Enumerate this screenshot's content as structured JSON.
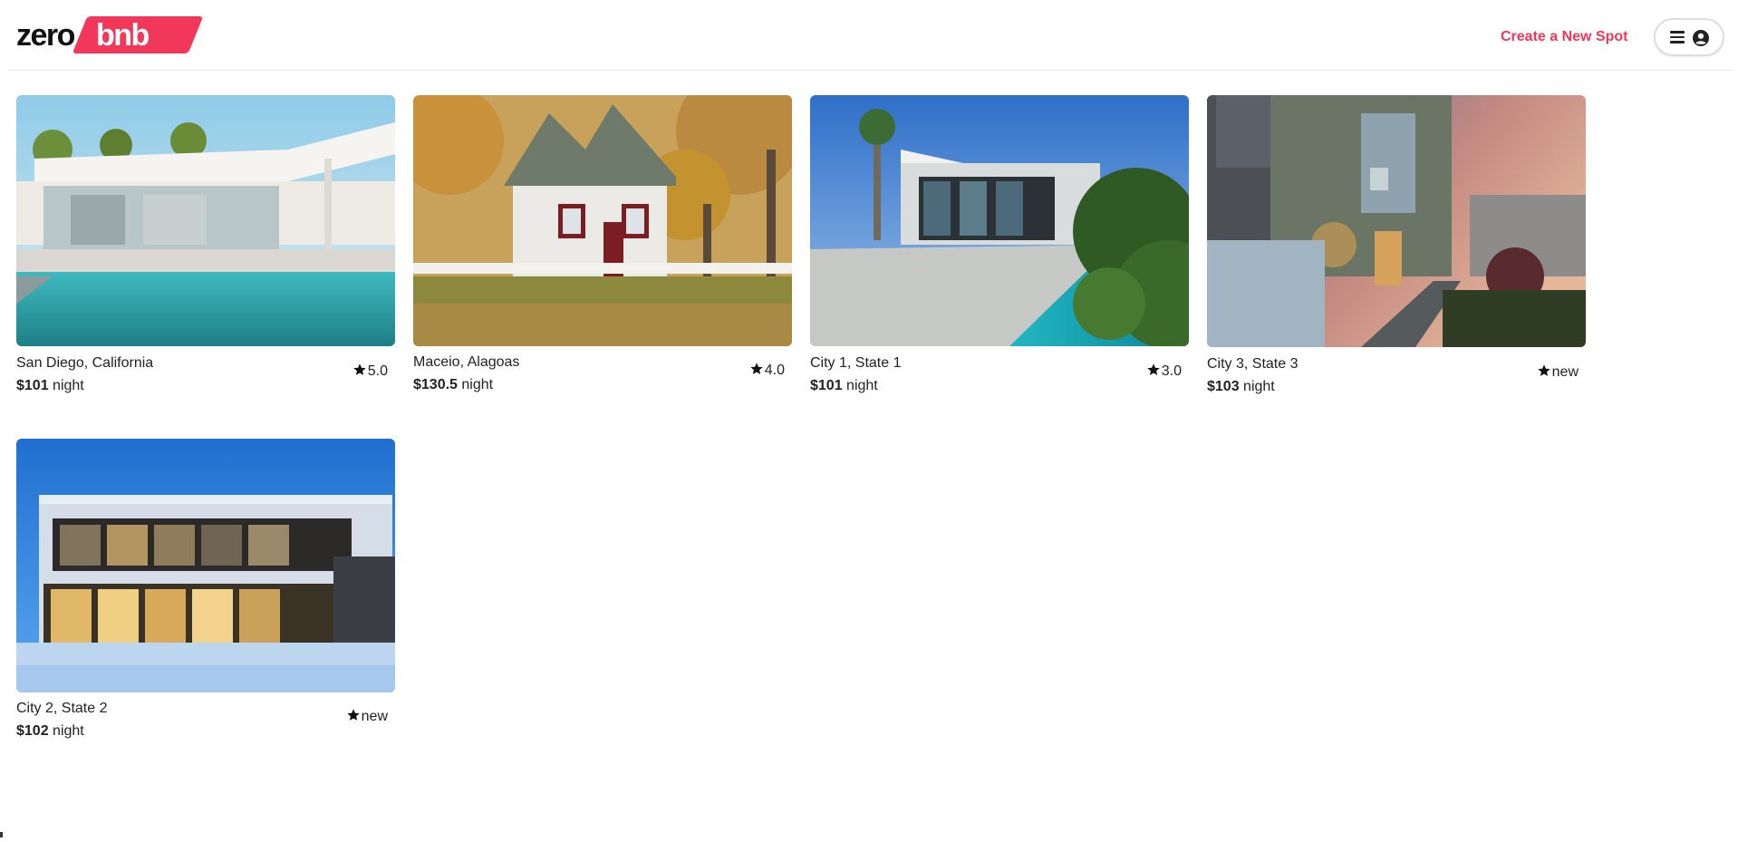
{
  "brand": {
    "logo_left": "zero",
    "logo_right": "bnb",
    "accent_color": "#f2385a"
  },
  "header": {
    "create_link": "Create a New Spot",
    "menu_icon": "hamburger-menu-icon",
    "user_icon": "user-circle-icon"
  },
  "spots": [
    {
      "location": "San Diego, California",
      "price": "$101",
      "unit": "night",
      "rating": "5.0",
      "image": "modern-house-with-pool"
    },
    {
      "location": "Maceio, Alagoas",
      "price": "$130.5",
      "unit": "night",
      "rating": "4.0",
      "image": "white-farmhouse-autumn"
    },
    {
      "location": "City 1, State 1",
      "price": "$101",
      "unit": "night",
      "rating": "3.0",
      "image": "modern-house-pool-palms"
    },
    {
      "location": "City 3, State 3",
      "price": "$103",
      "unit": "night",
      "rating": "new",
      "image": "green-modern-house-dusk"
    },
    {
      "location": "City 2, State 2",
      "price": "$102",
      "unit": "night",
      "rating": "new",
      "image": "glass-house-snow-night"
    }
  ]
}
